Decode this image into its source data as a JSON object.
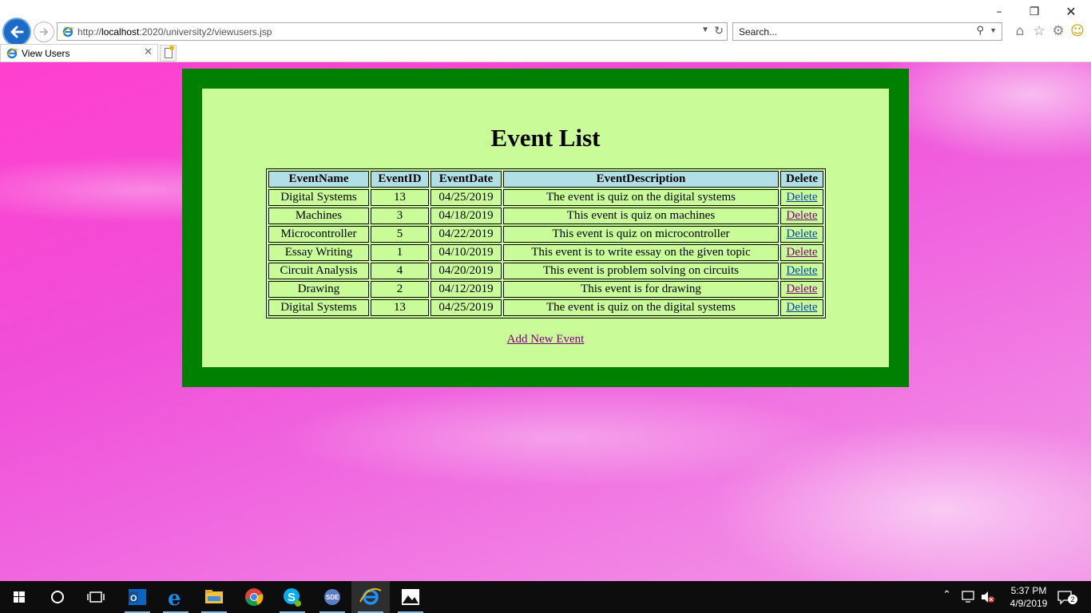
{
  "browser": {
    "url_prefix": "http://",
    "url_host": "localhost",
    "url_rest": ":2020/university2/viewusers.jsp",
    "search_placeholder": "Search...",
    "tab_title": "View Users"
  },
  "page": {
    "heading": "Event List",
    "table": {
      "headers": [
        "EventName",
        "EventID",
        "EventDate",
        "EventDescription",
        "Delete"
      ],
      "rows": [
        {
          "name": "Digital Systems",
          "id": "13",
          "date": "04/25/2019",
          "description": "The event is quiz on the digital systems",
          "delete": "Delete",
          "visited": false
        },
        {
          "name": "Machines",
          "id": "3",
          "date": "04/18/2019",
          "description": "This event is quiz on machines",
          "delete": "Delete",
          "visited": true
        },
        {
          "name": "Microcontroller",
          "id": "5",
          "date": "04/22/2019",
          "description": "This event is quiz on microcontroller",
          "delete": "Delete",
          "visited": false
        },
        {
          "name": "Essay Writing",
          "id": "1",
          "date": "04/10/2019",
          "description": "This event is to write essay on the given topic",
          "delete": "Delete",
          "visited": true
        },
        {
          "name": "Circuit Analysis",
          "id": "4",
          "date": "04/20/2019",
          "description": "This event is problem solving on circuits",
          "delete": "Delete",
          "visited": false
        },
        {
          "name": "Drawing",
          "id": "2",
          "date": "04/12/2019",
          "description": "This event is for drawing",
          "delete": "Delete",
          "visited": true
        },
        {
          "name": "Digital Systems",
          "id": "13",
          "date": "04/25/2019",
          "description": "The event is quiz on the digital systems",
          "delete": "Delete",
          "visited": false
        }
      ]
    },
    "add_link": "Add New Event"
  },
  "taskbar": {
    "time": "5:37 PM",
    "date": "4/9/2019",
    "notifications": "2",
    "apps": [
      "windows-start-icon",
      "cortana-search-icon",
      "task-view-icon",
      "outlook-icon",
      "edge-icon",
      "file-explorer-icon",
      "chrome-icon",
      "skype-icon",
      "sde-icon",
      "internet-explorer-icon",
      "photos-icon"
    ]
  },
  "colors": {
    "outer_border": "#008000",
    "inner_panel": "#c9fb98",
    "table_header": "#b0e0e6",
    "link": "#0645ad",
    "visited_link": "#800080"
  }
}
